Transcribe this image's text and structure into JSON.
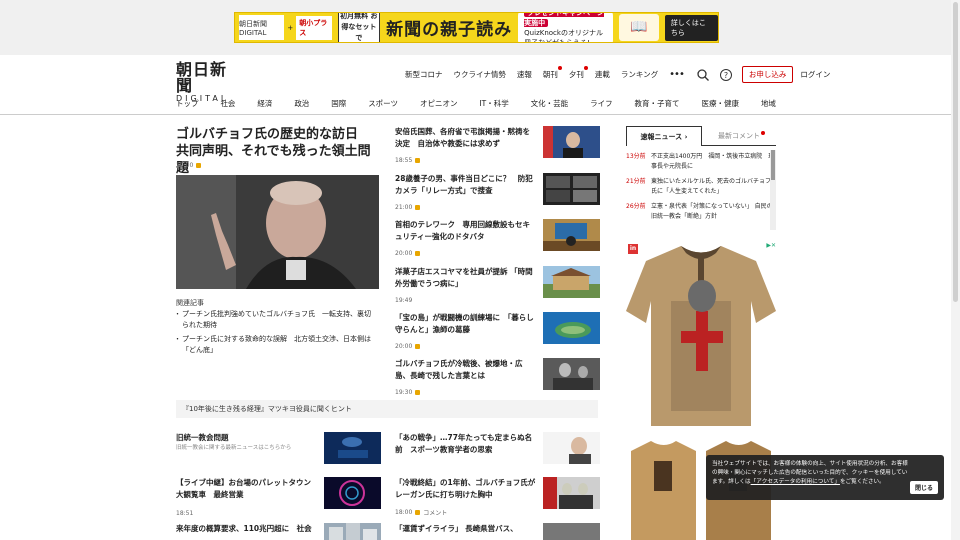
{
  "ad_banner": {
    "logo": "朝日新聞 DIGITAL",
    "plus": "+",
    "partner": "朝小プラス",
    "badge": "初月無料 お得なセットで",
    "headline": "新聞の親子読み",
    "promo_tag": "プレゼントキャンペーン実施中",
    "promo_text": "QuizKnockのオリジナル冊子などがもらえる!",
    "cta": "詳しくはこちら"
  },
  "masthead": {
    "logo_main": "朝日新聞",
    "logo_sub": "DIGITAL",
    "links": [
      "新型コロナ",
      "ウクライナ情勢",
      "速報",
      "朝刊",
      "夕刊",
      "連載",
      "ランキング"
    ],
    "more": "•••",
    "signup": "お申し込み",
    "login": "ログイン"
  },
  "categories": [
    "トップ",
    "社会",
    "経済",
    "政治",
    "国際",
    "スポーツ",
    "オピニオン",
    "IT・科学",
    "文化・芸能",
    "ライフ",
    "教育・子育て",
    "医療・健康",
    "地域"
  ],
  "lead": {
    "title": "ゴルバチョフ氏の歴史的な訪日　共同声明、それでも残った領土問題",
    "time": "19:00",
    "related_heading": "関連記事",
    "related": [
      "プーチン氏批判強めていたゴルバチョフ氏　一転支持、裏切られた期待",
      "プーチン氏に対する致命的な誤解　北方領土交渉、日本側は「どん底」"
    ]
  },
  "mid_stories": [
    {
      "title": "安倍氏国葬、各府省で弔旗掲揚・黙祷を決定　自治体や教委には求めず",
      "time": "18:55"
    },
    {
      "title": "28歳養子の男、事件当日どこに？　防犯カメラ「リレー方式」で捜査",
      "time": "21:00"
    },
    {
      "title": "首相のテレワーク　専用回線敷設もセキュリティー強化のドタバタ",
      "time": "20:00"
    },
    {
      "title": "洋菓子店エスコヤマを社員が提訴 「時間外労働でうつ病に」",
      "time": "19:49"
    },
    {
      "title": "「宝の島」が戦闘機の訓練場に　「暮らし守らんと」漁師の葛藤",
      "time": "20:00"
    },
    {
      "title": "ゴルバチョフ氏が冷戦後、被爆地・広島、長崎で残した言葉とは",
      "time": "19:30"
    }
  ],
  "banner_row": "『10年後に生き残る経理』マツキヨ役員に聞くヒント",
  "bottom_left": [
    {
      "title": "旧統一教会問題",
      "sub": "旧統一教会に関する最新ニュースはこちらから",
      "time": ""
    },
    {
      "title": "【ライブ中継】お台場のパレットタウン大観覧車　最終営業",
      "sub": "",
      "time": "18:51"
    },
    {
      "title": "来年度の概算要求、110兆円超に　社会",
      "sub": "",
      "time": ""
    }
  ],
  "bottom_right": [
    {
      "title": "「あの戦争」…77年たっても定まらぬ名前　スポーツ教育学者の思索",
      "time": ""
    },
    {
      "title": "「冷戦終結」の1年前、ゴルバチョフ氏がレーガン氏に打ち明けた胸中",
      "time": "18:00",
      "extra": "コメント"
    },
    {
      "title": "「運賃ずイライラ」 長崎県営バス、",
      "time": ""
    }
  ],
  "sidebar": {
    "tab_active": "速報ニュース",
    "tab_other": "最新コメント",
    "news": [
      {
        "ago": "13分前",
        "text": "不正支出1400万円　福岡・筑後市立病院　理事長や元院長に"
      },
      {
        "ago": "21分前",
        "text": "東独にいたメルケル氏、死去のゴルバチョフ氏に「人生変えてくれた」"
      },
      {
        "ago": "26分前",
        "text": "立憲・泉代表「対策になっていない」 自民の旧統一教会「断絶」方針"
      }
    ]
  },
  "cookie": {
    "text_before": "当社ウェブサイトでは、お客様の体験の向上、サイト使用状況の分析、お客様の興味・関心にマッチした広告の配信といった目的で、クッキーを使用しています。詳しくは",
    "link": "「アクセスデータの利用について」",
    "text_after": "をご覧ください。",
    "close": "閉じる"
  },
  "colors": {
    "accent": "#cc0000",
    "lock": "#e8a600",
    "ad_yellow": "#f5d61c"
  }
}
